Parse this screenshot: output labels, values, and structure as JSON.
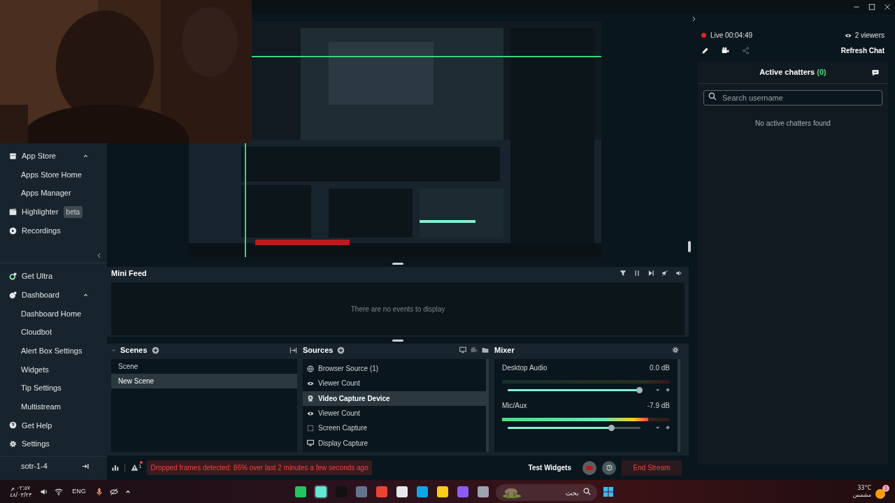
{
  "sidebar": {
    "top_items": [
      {
        "label": "App Store",
        "expanded": true,
        "children": [
          {
            "label": "Apps Store Home"
          },
          {
            "label": "Apps Manager"
          }
        ]
      },
      {
        "label": "Highlighter",
        "badge": "beta"
      },
      {
        "label": "Recordings"
      }
    ],
    "bottom_items": [
      {
        "label": "Get Ultra"
      },
      {
        "label": "Dashboard",
        "expanded": true,
        "children": [
          {
            "label": "Dashboard Home"
          },
          {
            "label": "Cloudbot"
          },
          {
            "label": "Alert Box Settings"
          },
          {
            "label": "Widgets"
          },
          {
            "label": "Tip Settings"
          },
          {
            "label": "Multistream"
          }
        ]
      },
      {
        "label": "Get Help"
      },
      {
        "label": "Settings"
      }
    ],
    "user": "sotr-1-4"
  },
  "mini_feed": {
    "title": "Mini Feed",
    "empty_message": "There are no events to display"
  },
  "scenes": {
    "title": "Scenes",
    "items": [
      {
        "label": "Scene",
        "selected": false
      },
      {
        "label": "New Scene",
        "selected": true
      }
    ]
  },
  "sources": {
    "title": "Sources",
    "items": [
      {
        "label": "Browser Source (1)",
        "selected": false
      },
      {
        "label": "Viewer Count",
        "selected": false
      },
      {
        "label": "Video Capture Device",
        "selected": true
      },
      {
        "label": "Viewer Count",
        "selected": false
      },
      {
        "label": "Screen Capture",
        "selected": false
      },
      {
        "label": "Display Capture",
        "selected": false
      }
    ]
  },
  "mixer": {
    "title": "Mixer",
    "channels": [
      {
        "name": "Desktop Audio",
        "reading": "0.0 dB",
        "meter": {
          "level": 0
        },
        "volume": {
          "level": 0.99
        }
      },
      {
        "name": "Mic/Aux",
        "reading": "-7.9 dB",
        "meter": {
          "level": 0.87
        },
        "volume": {
          "level": 0.78
        }
      }
    ]
  },
  "footer": {
    "alert_count": "1",
    "warning": "Dropped frames detected: 86% over last 2 minutes a few seconds ago",
    "test_widgets": "Test Widgets",
    "end_stream": "End Stream"
  },
  "chat": {
    "live": "Live 00:04:49",
    "viewers": "2 viewers",
    "refresh": "Refresh Chat",
    "title": "Active chatters",
    "count": "(0)",
    "search_placeholder": "Search username",
    "empty_message": "No active chatters found"
  },
  "taskbar": {
    "time": "٠٢:٥٧ م",
    "date": "٤٨/٠٣/٢٣",
    "language": "ENG",
    "search_placeholder": "بحث",
    "temperature": "33°C",
    "weather": "مشمس",
    "weather_badge": "1"
  }
}
